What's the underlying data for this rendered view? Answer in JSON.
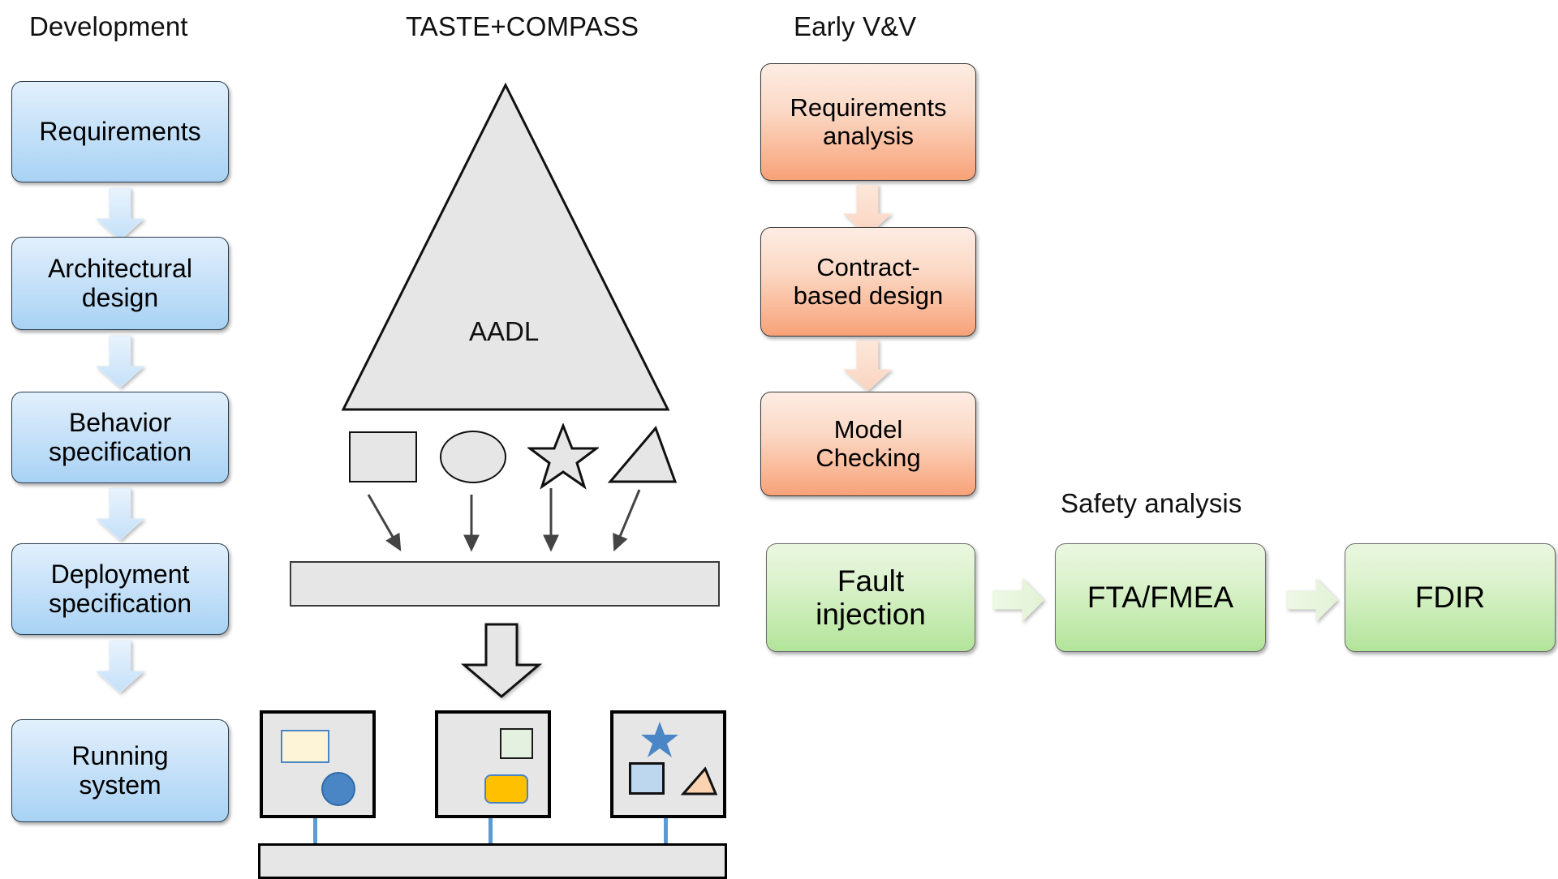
{
  "columns": {
    "development": {
      "title": "Development"
    },
    "taste": {
      "title": "TASTE+COMPASS"
    },
    "vv": {
      "title": "Early V&V"
    },
    "safety": {
      "title": "Safety analysis"
    }
  },
  "development_flow": {
    "steps": [
      {
        "label": "Requirements"
      },
      {
        "label": "Architectural\ndesign",
        "line1": "Architectural",
        "line2": "design"
      },
      {
        "label": "Behavior\nspecification",
        "line1": "Behavior",
        "line2": "specification"
      },
      {
        "label": "Deployment\nspecification",
        "line1": "Deployment",
        "line2": "specification"
      },
      {
        "label": "Running\nsystem",
        "line1": "Running",
        "line2": "system"
      }
    ]
  },
  "taste_flow": {
    "model_label": "AADL",
    "shapes": [
      {
        "name": "square"
      },
      {
        "name": "ellipse"
      },
      {
        "name": "star"
      },
      {
        "name": "triangle"
      }
    ],
    "deployment_nodes": [
      {
        "elements": [
          {
            "name": "cream-rectangle"
          },
          {
            "name": "blue-circle"
          }
        ]
      },
      {
        "elements": [
          {
            "name": "pale-green-square"
          },
          {
            "name": "orange-rounded-rectangle"
          }
        ]
      },
      {
        "elements": [
          {
            "name": "blue-star"
          },
          {
            "name": "light-blue-square"
          },
          {
            "name": "peach-triangle"
          }
        ]
      }
    ]
  },
  "vv_flow": {
    "steps": [
      {
        "line1": "Requirements",
        "line2": "analysis"
      },
      {
        "line1": "Contract-",
        "line2": "based design"
      },
      {
        "line1": "Model",
        "line2": "Checking"
      }
    ]
  },
  "safety_flow": {
    "steps": [
      {
        "line1": "Fault",
        "line2": "injection"
      },
      {
        "line1": "FTA/FMEA",
        "line2": ""
      },
      {
        "line1": "FDIR",
        "line2": ""
      }
    ]
  },
  "colors": {
    "blue_box_top": "#e2f0fc",
    "blue_box_bottom": "#a8d2f4",
    "orange_box_top": "#fdece3",
    "orange_box_bottom": "#f8a278",
    "green_box_top": "#eaf7e0",
    "green_box_bottom": "#b2e49a",
    "grey_fill": "#e6e6e6",
    "outline": "#111111",
    "link_blue": "#5b9bd5",
    "cream": "#fdf3d7",
    "amber": "#ffc000",
    "pale_green": "#e5f1e0",
    "peach": "#fbd3b0",
    "light_blue": "#bdd7ee",
    "steel_blue": "#4a86c5"
  }
}
